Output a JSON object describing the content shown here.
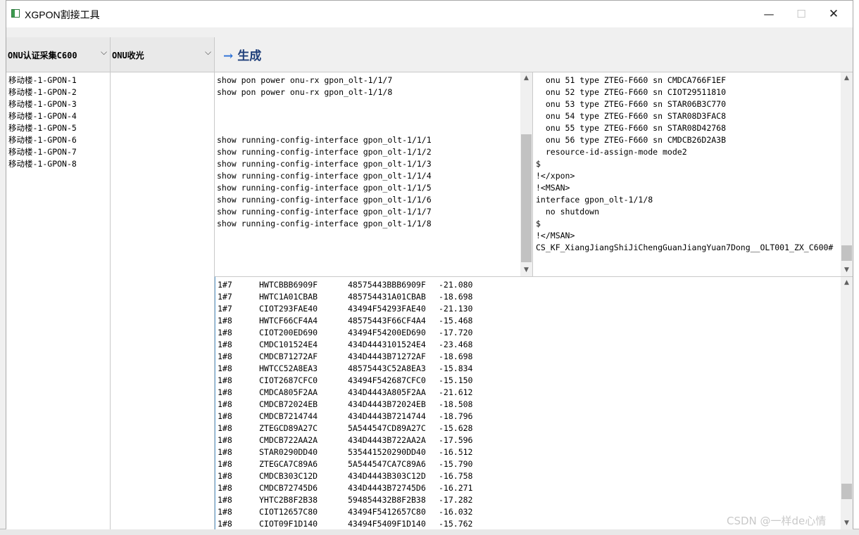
{
  "window": {
    "title": "XGPON割接工具"
  },
  "combos": [
    {
      "label": "ONU认证采集C600"
    },
    {
      "label": "ONU收光"
    }
  ],
  "toolbar": {
    "generate_label": "生成"
  },
  "left_list": {
    "items": [
      "移动楼-1-GPON-1",
      "移动楼-1-GPON-2",
      "移动楼-1-GPON-3",
      "移动楼-1-GPON-4",
      "移动楼-1-GPON-5",
      "移动楼-1-GPON-6",
      "移动楼-1-GPON-7",
      "移动楼-1-GPON-8"
    ]
  },
  "command_pane": {
    "lines": [
      "show pon power onu-rx gpon_olt-1/1/7",
      "show pon power onu-rx gpon_olt-1/1/8",
      "",
      "",
      "",
      "show running-config-interface gpon_olt-1/1/1",
      "show running-config-interface gpon_olt-1/1/2",
      "show running-config-interface gpon_olt-1/1/3",
      "show running-config-interface gpon_olt-1/1/4",
      "show running-config-interface gpon_olt-1/1/5",
      "show running-config-interface gpon_olt-1/1/6",
      "show running-config-interface gpon_olt-1/1/7",
      "show running-config-interface gpon_olt-1/1/8"
    ]
  },
  "output_pane": {
    "lines": [
      "  onu 51 type ZTEG-F660 sn CMDCA766F1EF",
      "  onu 52 type ZTEG-F660 sn CIOT29511810",
      "  onu 53 type ZTEG-F660 sn STAR06B3C770",
      "  onu 54 type ZTEG-F660 sn STAR08D3FAC8",
      "  onu 55 type ZTEG-F660 sn STAR08D42768",
      "  onu 56 type ZTEG-F660 sn CMDCB26D2A3B",
      "  resource-id-assign-mode mode2",
      "$",
      "!</xpon>",
      "!<MSAN>",
      "interface gpon_olt-1/1/8",
      "  no shutdown",
      "$",
      "!</MSAN>",
      "CS_KF_XiangJiangShiJiChengGuanJiangYuan7Dong__OLT001_ZX_C600#"
    ]
  },
  "results": {
    "rows": [
      [
        "1#7",
        "HWTCBBB6909F",
        "48575443BBB6909F",
        "-21.080"
      ],
      [
        "1#7",
        "HWTC1A01CBAB",
        "485754431A01CBAB",
        "-18.698"
      ],
      [
        "1#7",
        "CIOT293FAE40",
        "43494F54293FAE40",
        "-21.130"
      ],
      [
        "1#8",
        "HWTCF66CF4A4",
        "48575443F66CF4A4",
        "-15.468"
      ],
      [
        "1#8",
        "CIOT200ED690",
        "43494F54200ED690",
        "-17.720"
      ],
      [
        "1#8",
        "CMDC101524E4",
        "434D4443101524E4",
        "-23.468"
      ],
      [
        "1#8",
        "CMDCB71272AF",
        "434D4443B71272AF",
        "-18.698"
      ],
      [
        "1#8",
        "HWTCC52A8EA3",
        "48575443C52A8EA3",
        "-15.834"
      ],
      [
        "1#8",
        "CIOT2687CFC0",
        "43494F542687CFC0",
        "-15.150"
      ],
      [
        "1#8",
        "CMDCA805F2AA",
        "434D4443A805F2AA",
        "-21.612"
      ],
      [
        "1#8",
        "CMDCB72024EB",
        "434D4443B72024EB",
        "-18.508"
      ],
      [
        "1#8",
        "CMDCB7214744",
        "434D4443B7214744",
        "-18.796"
      ],
      [
        "1#8",
        "ZTEGCD89A27C",
        "5A544547CD89A27C",
        "-15.628"
      ],
      [
        "1#8",
        "CMDCB722AA2A",
        "434D4443B722AA2A",
        "-17.596"
      ],
      [
        "1#8",
        "STAR0290DD40",
        "535441520290DD40",
        "-16.512"
      ],
      [
        "1#8",
        "ZTEGCA7C89A6",
        "5A544547CA7C89A6",
        "-15.790"
      ],
      [
        "1#8",
        "CMDCB303C12D",
        "434D4443B303C12D",
        "-16.758"
      ],
      [
        "1#8",
        "CMDCB72745D6",
        "434D4443B72745D6",
        "-16.271"
      ],
      [
        "1#8",
        "YHTC2B8F2B38",
        "594854432B8F2B38",
        "-17.282"
      ],
      [
        "1#8",
        "CIOT12657C80",
        "43494F5412657C80",
        "-16.032"
      ],
      [
        "1#8",
        "CIOT09F1D140",
        "43494F5409F1D140",
        "-15.762"
      ]
    ]
  },
  "watermark": "CSDN @一样de心情"
}
